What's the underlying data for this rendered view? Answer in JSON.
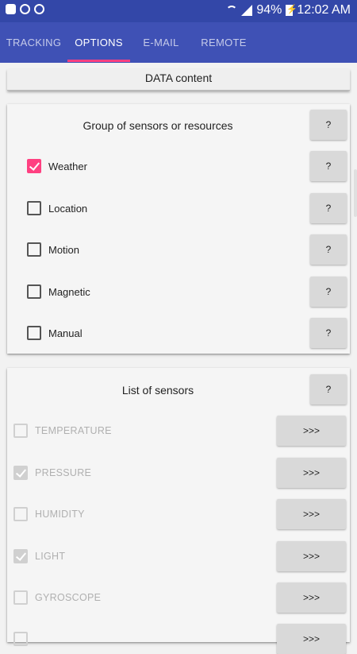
{
  "status_bar": {
    "battery": "94%",
    "time": "12:02 AM",
    "left_icons": [
      "notification-icon",
      "sync-icon",
      "block-icon"
    ]
  },
  "tabs": [
    {
      "label": "TRACKING"
    },
    {
      "label": "OPTIONS"
    },
    {
      "label": "E-MAIL"
    },
    {
      "label": "REMOTE"
    }
  ],
  "data_content_label": "DATA content",
  "groups_card": {
    "title": "Group of sensors or resources",
    "help_label": "?",
    "items": [
      {
        "label": "Weather",
        "checked": true
      },
      {
        "label": "Location",
        "checked": false
      },
      {
        "label": "Motion",
        "checked": false
      },
      {
        "label": "Magnetic",
        "checked": false
      },
      {
        "label": "Manual",
        "checked": false
      }
    ]
  },
  "sensors_card": {
    "title": "List of sensors",
    "help_label": "?",
    "action_label": ">>>",
    "items": [
      {
        "label": "TEMPERATURE",
        "checked": false
      },
      {
        "label": "PRESSURE",
        "checked": true
      },
      {
        "label": "HUMIDITY",
        "checked": false
      },
      {
        "label": "LIGHT",
        "checked": true
      },
      {
        "label": "GYROSCOPE",
        "checked": false
      }
    ]
  },
  "colors": {
    "status_bar": "#3347a8",
    "tab_bar": "#3f51b5",
    "indicator": "#ff4081",
    "checkbox_checked": "#ff4081"
  }
}
